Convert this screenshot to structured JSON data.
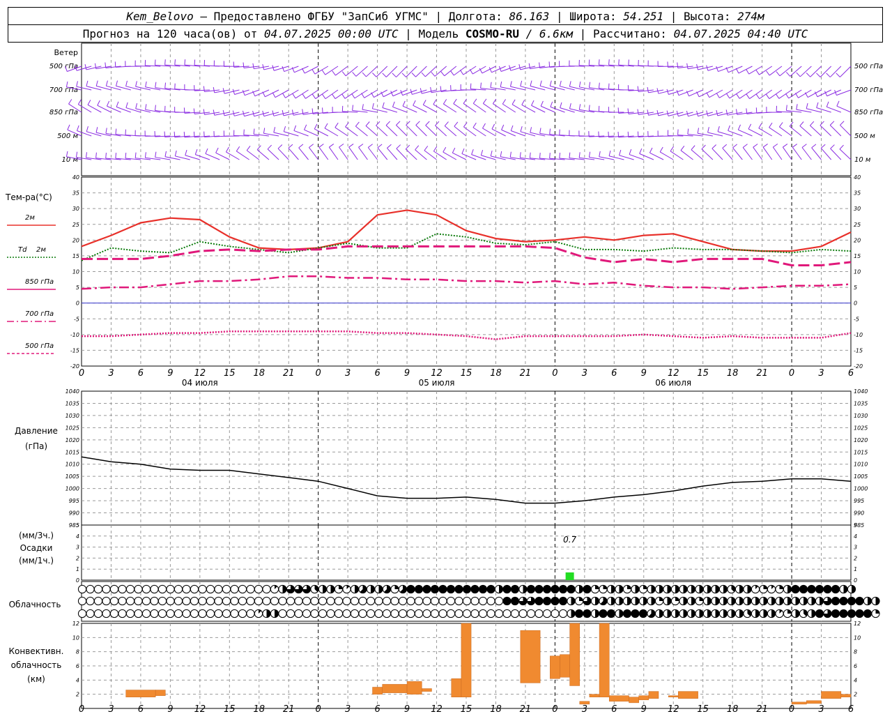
{
  "header": {
    "station": "Kem_Belovo",
    "dash": "–",
    "provided_by": "Предоставлено ФГБУ \"ЗапСиб УГМС\"",
    "lon_label": "Долгота:",
    "lon_value": "86.163",
    "lat_label": "Широта:",
    "lat_value": "54.251",
    "alt_label": "Высота:",
    "alt_value": "274м",
    "sep": "|",
    "forecast_label": "Прогноз на 120 часа(ов) от",
    "forecast_from": "04.07.2025 00:00 UTC",
    "model_label": "Модель",
    "model_name": "COSMO-RU",
    "model_res": "/ 6.6км",
    "computed_label": "Рассчитано:",
    "computed_at": "04.07.2025 04:40 UTC"
  },
  "labels": {
    "wind": "Ветер",
    "wind_levels": [
      "500 гПа",
      "700 гПа",
      "850 гПа",
      "500 м",
      "10  м"
    ],
    "temp_title": "Тем-ра(°C)",
    "temp_2m": "2м",
    "td_prefix": "Td",
    "td_2m": "2м",
    "t850": "850 гПа",
    "t700": "700 гПа",
    "t500": "500 гПа",
    "pressure_1": "Давление",
    "pressure_2": "(гПа)",
    "precip_1": "(мм/3ч.)",
    "precip_2": "Осадки",
    "precip_3": "(мм/1ч.)",
    "precip_value_label": "0.7",
    "clouds": "Облачность",
    "conv_1": "Конвективн.",
    "conv_2": "облачность",
    "conv_3": "(км)",
    "dates": [
      "04 июля",
      "05 июля",
      "06 июля"
    ]
  },
  "colors": {
    "wind": "#8a2be2",
    "t2m": "#e8302a",
    "td": "#0a7a0a",
    "t850": "#e0187a",
    "t700": "#e0187a",
    "t500": "#e0187a",
    "zero": "#3333cc",
    "pressure": "#000000",
    "precip": "#22dd22",
    "conv": "#f08a30",
    "grid": "#999999"
  },
  "chart_data": [
    {
      "type": "line",
      "name": "temperature",
      "x_hours": [
        0,
        3,
        6,
        9,
        12,
        15,
        18,
        21,
        24,
        27,
        30,
        33,
        36,
        39,
        42,
        45,
        48,
        51,
        54,
        57,
        60,
        63,
        66,
        69,
        72,
        75,
        78
      ],
      "x_tick_labels": [
        "0",
        "3",
        "6",
        "9",
        "12",
        "15",
        "18",
        "21",
        "0",
        "3",
        "6",
        "9",
        "12",
        "15",
        "18",
        "21",
        "0",
        "3",
        "6",
        "9",
        "12",
        "15",
        "18",
        "21",
        "0",
        "3",
        "6"
      ],
      "ylim": [
        -20,
        40
      ],
      "y_ticks": [
        -20,
        -15,
        -10,
        -5,
        0,
        5,
        10,
        15,
        20,
        25,
        30,
        35,
        40
      ],
      "series": [
        {
          "name": "2м",
          "x": [
            0,
            3,
            6,
            9,
            12,
            15,
            18,
            21,
            24,
            27,
            30,
            33,
            36,
            39,
            42,
            45,
            48,
            51,
            54,
            57,
            60,
            63,
            66,
            69,
            72,
            75,
            78
          ],
          "values": [
            18,
            21.5,
            25.5,
            27,
            26.5,
            21,
            17.5,
            17,
            17.5,
            19.5,
            28,
            29.5,
            28,
            23,
            20.5,
            19.5,
            20,
            21,
            20,
            21.5,
            22,
            19.5,
            17,
            16.5,
            16.5,
            18,
            22.5
          ]
        },
        {
          "name": "Td 2м",
          "x": [
            0,
            3,
            6,
            9,
            12,
            15,
            18,
            21,
            24,
            27,
            30,
            33,
            36,
            39,
            42,
            45,
            48,
            51,
            54,
            57,
            60,
            63,
            66,
            69,
            72,
            75,
            78
          ],
          "values": [
            13.5,
            17.5,
            16.5,
            16,
            19.5,
            18,
            17,
            16,
            17.5,
            19,
            17.5,
            17.5,
            22,
            21,
            19,
            18.5,
            19.5,
            17,
            17,
            16.5,
            17.5,
            17,
            17,
            16.5,
            16,
            17,
            16.5
          ]
        },
        {
          "name": "850 гПа",
          "x": [
            0,
            3,
            6,
            9,
            12,
            15,
            18,
            21,
            24,
            27,
            30,
            33,
            36,
            39,
            42,
            45,
            48,
            51,
            54,
            57,
            60,
            63,
            66,
            69,
            72,
            75,
            78
          ],
          "values": [
            14,
            14,
            14,
            15,
            16.5,
            17,
            16.5,
            17,
            17,
            18,
            18,
            18,
            18,
            18,
            18,
            18,
            17.5,
            14.5,
            13,
            14,
            13,
            14,
            14,
            14,
            12,
            12,
            13
          ]
        },
        {
          "name": "700 гПа",
          "x": [
            0,
            3,
            6,
            9,
            12,
            15,
            18,
            21,
            24,
            27,
            30,
            33,
            36,
            39,
            42,
            45,
            48,
            51,
            54,
            57,
            60,
            63,
            66,
            69,
            72,
            75,
            78
          ],
          "values": [
            4.5,
            5,
            5,
            6,
            7,
            7,
            7.5,
            8.5,
            8.5,
            8,
            8,
            7.5,
            7.5,
            7,
            7,
            6.5,
            7,
            6,
            6.5,
            5.5,
            5,
            5,
            4.5,
            5,
            5.5,
            5.5,
            6
          ]
        },
        {
          "name": "500 гПа",
          "x": [
            0,
            3,
            6,
            9,
            12,
            15,
            18,
            21,
            24,
            27,
            30,
            33,
            36,
            39,
            42,
            45,
            48,
            51,
            54,
            57,
            60,
            63,
            66,
            69,
            72,
            75,
            78
          ],
          "values": [
            -10.5,
            -10.5,
            -10,
            -9.5,
            -9.5,
            -9,
            -9,
            -9,
            -9,
            -9,
            -9.5,
            -9.5,
            -10,
            -10.5,
            -11.5,
            -10.5,
            -10.5,
            -10.5,
            -10.5,
            -10,
            -10.5,
            -11,
            -10.5,
            -11,
            -11,
            -11,
            -9.5
          ]
        }
      ]
    },
    {
      "type": "line",
      "name": "pressure",
      "ylim": [
        985,
        1040
      ],
      "y_ticks": [
        985,
        990,
        995,
        1000,
        1005,
        1010,
        1015,
        1020,
        1025,
        1030,
        1035,
        1040
      ],
      "x": [
        0,
        3,
        6,
        9,
        12,
        15,
        18,
        21,
        24,
        27,
        30,
        33,
        36,
        39,
        42,
        45,
        48,
        51,
        54,
        57,
        60,
        63,
        66,
        69,
        72,
        75,
        78
      ],
      "values": [
        1013,
        1011,
        1010,
        1008,
        1007.5,
        1007.5,
        1006,
        1004.5,
        1003,
        1000,
        997,
        996,
        996,
        996.5,
        995.5,
        994,
        994,
        995,
        996.5,
        997.5,
        999,
        1001,
        1002.5,
        1003,
        1004,
        1004,
        1003
      ]
    },
    {
      "type": "bar",
      "name": "precipitation",
      "ylim": [
        0,
        5
      ],
      "y_ticks": [
        0,
        1,
        2,
        3,
        4,
        5
      ],
      "x": [
        49.5
      ],
      "values": [
        0.7
      ]
    },
    {
      "type": "bar",
      "name": "convective_cloudiness",
      "ylim": [
        0,
        12
      ],
      "y_ticks": [
        2,
        4,
        6,
        8,
        10,
        12
      ],
      "bars": [
        {
          "x0": 4.5,
          "x1": 7.5,
          "bottom": 1.6,
          "top": 2.6
        },
        {
          "x0": 7.5,
          "x1": 8.5,
          "bottom": 1.8,
          "top": 2.6
        },
        {
          "x0": 29.5,
          "x1": 30.5,
          "bottom": 2,
          "top": 3
        },
        {
          "x0": 30.5,
          "x1": 33,
          "bottom": 2.2,
          "top": 3.4
        },
        {
          "x0": 33,
          "x1": 34.5,
          "bottom": 2,
          "top": 3.8
        },
        {
          "x0": 34.5,
          "x1": 35.5,
          "bottom": 2.4,
          "top": 2.8
        },
        {
          "x0": 37.5,
          "x1": 38.5,
          "bottom": 1.6,
          "top": 4.2
        },
        {
          "x0": 38.5,
          "x1": 39.5,
          "bottom": 1.6,
          "top": 12
        },
        {
          "x0": 44.5,
          "x1": 46.5,
          "bottom": 3.6,
          "top": 11
        },
        {
          "x0": 47.5,
          "x1": 48.5,
          "bottom": 4.2,
          "top": 7.4
        },
        {
          "x0": 48.5,
          "x1": 49.5,
          "bottom": 4.4,
          "top": 7.6
        },
        {
          "x0": 49.5,
          "x1": 50.5,
          "bottom": 3.2,
          "top": 12
        },
        {
          "x0": 50.5,
          "x1": 51.5,
          "bottom": 0.6,
          "top": 1
        },
        {
          "x0": 51.5,
          "x1": 52.5,
          "bottom": 1.6,
          "top": 2
        },
        {
          "x0": 52.5,
          "x1": 53.5,
          "bottom": 1.6,
          "top": 12
        },
        {
          "x0": 53.5,
          "x1": 55.5,
          "bottom": 1,
          "top": 1.8
        },
        {
          "x0": 55.5,
          "x1": 56.5,
          "bottom": 0.8,
          "top": 1.6
        },
        {
          "x0": 56.5,
          "x1": 57.5,
          "bottom": 1.2,
          "top": 1.8
        },
        {
          "x0": 57.5,
          "x1": 58.5,
          "bottom": 1.4,
          "top": 2.4
        },
        {
          "x0": 59.5,
          "x1": 60.5,
          "bottom": 1.6,
          "top": 1.8
        },
        {
          "x0": 60.5,
          "x1": 62.5,
          "bottom": 1.4,
          "top": 2.4
        },
        {
          "x0": 72,
          "x1": 73.5,
          "bottom": 0.6,
          "top": 0.9
        },
        {
          "x0": 73.5,
          "x1": 75,
          "bottom": 0.7,
          "top": 1.1
        },
        {
          "x0": 75,
          "x1": 77,
          "bottom": 1.4,
          "top": 2.4
        },
        {
          "x0": 77,
          "x1": 78,
          "bottom": 1.6,
          "top": 2
        }
      ]
    }
  ],
  "cloud_cover": {
    "rows": [
      "0000000000000000000000001466634421454452588888888888488488888848224424244444444443441212488888844",
      "0000000000000000000000000000000000000000000000000000088668888426454444442424424444444444444446888844",
      "0000000000000000000000144000000000000000000000000000000000000488488488854444444444434441243486888882"
    ]
  }
}
